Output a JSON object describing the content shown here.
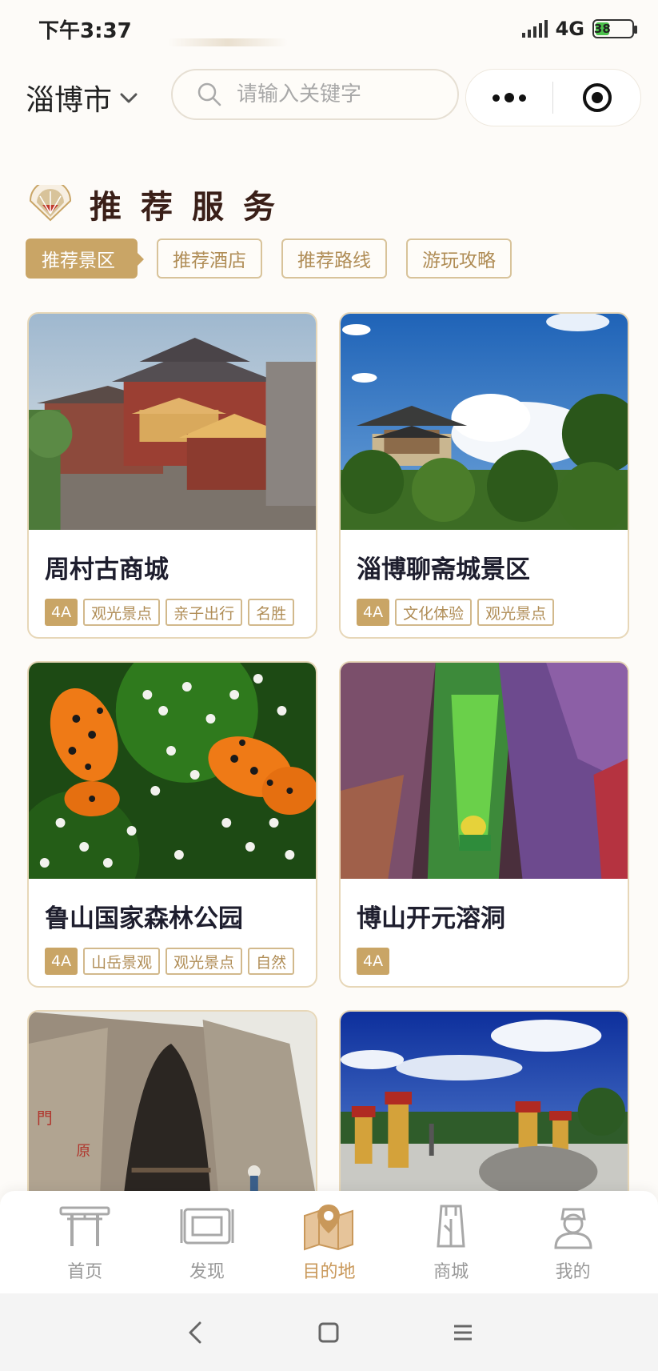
{
  "status_bar": {
    "time": "下午3:37",
    "network": "4G",
    "battery_level": "38",
    "battery_percent": 38
  },
  "header": {
    "city": "淄博市",
    "search_placeholder": "请输入关键字"
  },
  "section": {
    "title": "推荐服务"
  },
  "tabs": [
    {
      "label": "推荐景区",
      "active": true
    },
    {
      "label": "推荐酒店",
      "active": false
    },
    {
      "label": "推荐路线",
      "active": false
    },
    {
      "label": "游玩攻略",
      "active": false
    }
  ],
  "cards": [
    {
      "name": "周村古商城",
      "level": "4A",
      "tags": [
        "观光景点",
        "亲子出行",
        "名胜"
      ]
    },
    {
      "name": "淄博聊斋城景区",
      "level": "4A",
      "tags": [
        "文化体验",
        "观光景点"
      ]
    },
    {
      "name": "鲁山国家森林公园",
      "level": "4A",
      "tags": [
        "山岳景观",
        "观光景点",
        "自然"
      ]
    },
    {
      "name": "博山开元溶洞",
      "level": "4A",
      "tags": []
    }
  ],
  "bottom_nav": [
    {
      "label": "首页",
      "icon": "home-gate-icon",
      "active": false
    },
    {
      "label": "发现",
      "icon": "scroll-icon",
      "active": false
    },
    {
      "label": "目的地",
      "icon": "map-pin-icon",
      "active": true
    },
    {
      "label": "商城",
      "icon": "shop-robe-icon",
      "active": false
    },
    {
      "label": "我的",
      "icon": "person-icon",
      "active": false
    }
  ],
  "colors": {
    "accent": "#c9a566",
    "accent_text": "#b08d56",
    "title": "#3a1f18",
    "background": "#fdfbf8"
  }
}
